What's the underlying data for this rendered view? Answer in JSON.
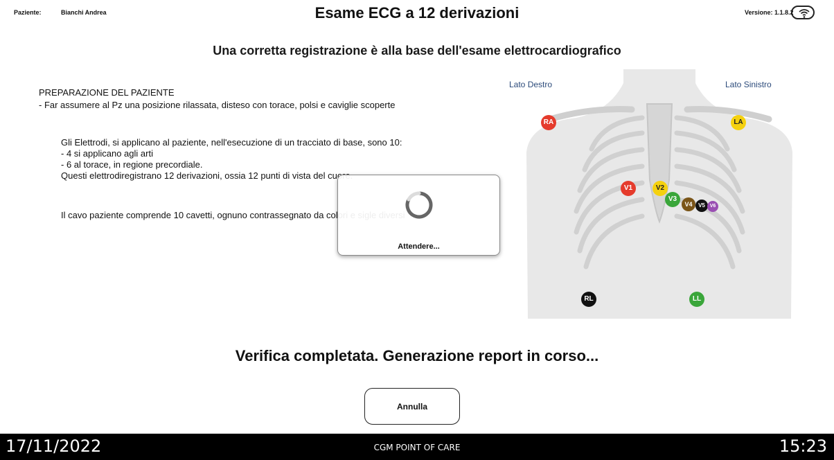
{
  "header": {
    "patient_label": "Paziente:",
    "patient_name": "Bianchi Andrea",
    "title": "Esame ECG a 12 derivazioni",
    "version": "Versione: 1.1.8.2",
    "wifi_icon": "wifi-icon"
  },
  "subtitle": "Una corretta registrazione è alla base dell'esame elettrocardiografico",
  "instructions": {
    "heading": "PREPARAZIONE DEL PAZIENTE",
    "line1": "- Far assumere al Pz una posizione rilassata, disteso con torace, polsi e caviglie scoperte",
    "electrodes": [
      "Gli Elettrodi, si applicano al paziente, nell'esecuzione di un tracciato di base, sono 10:",
      "- 4 si applicano agli arti",
      "- 6 al torace, in regione precordiale.",
      "Questi elettrodiregistrano 12 derivazioni, ossia 12 punti di vista del cuore."
    ],
    "cable": "Il cavo paziente comprende 10 cavetti, ognuno contrassegnato da colori e sigle diversi"
  },
  "diagram": {
    "right_side_label": "Lato Destro",
    "left_side_label": "Lato Sinistro",
    "electrodes": [
      {
        "label": "RA",
        "color": "#e53b2c"
      },
      {
        "label": "LA",
        "color": "#f5d10f"
      },
      {
        "label": "V1",
        "color": "#e53b2c"
      },
      {
        "label": "V2",
        "color": "#f5d10f"
      },
      {
        "label": "V3",
        "color": "#3aa63a"
      },
      {
        "label": "V4",
        "color": "#7a5518"
      },
      {
        "label": "V5",
        "color": "#111111"
      },
      {
        "label": "V6",
        "color": "#9a4fb3"
      },
      {
        "label": "RL",
        "color": "#111111"
      },
      {
        "label": "LL",
        "color": "#3aa63a"
      }
    ]
  },
  "modal": {
    "text": "Attendere..."
  },
  "status": "Verifica completata. Generazione report in corso...",
  "buttons": {
    "cancel": "Annulla"
  },
  "footer": {
    "date": "17/11/2022",
    "app_name": "CGM POINT OF CARE",
    "time": "15:23"
  }
}
